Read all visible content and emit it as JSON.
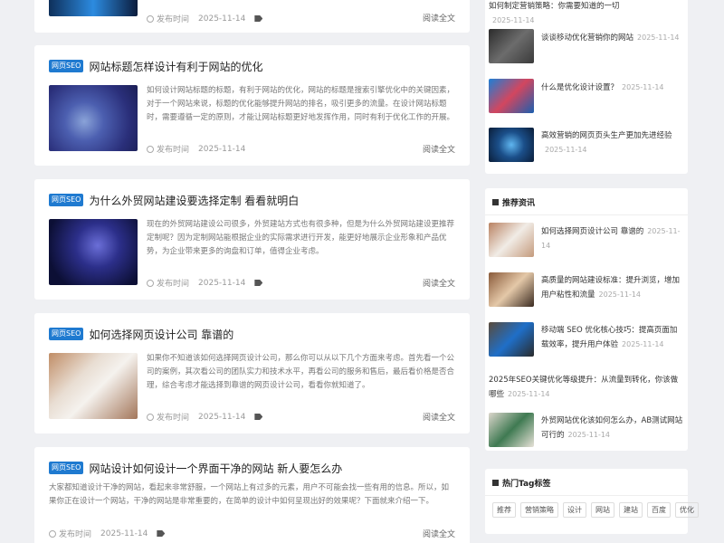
{
  "top_article": {
    "meta": {
      "author": "发布时间",
      "date": "2025-11-14"
    },
    "readmore": "阅读全文"
  },
  "articles": [
    {
      "badge": "网页SEO",
      "title": "网站标题怎样设计有利于网站的优化",
      "excerpt": "如何设计网站标题的标题，有利于网站的优化，网站的标题是搜索引擎优化中的关键因素，对于一个网站来说，标题的优化能够提升网站的排名，吸引更多的流量。在设计网站标题时，需要遵循一定的原则，才能让网站标题更好地发挥作用，同时有利于优化工作的开展。",
      "meta": {
        "author": "发布时间",
        "date": "2025-11-14"
      },
      "readmore": "阅读全文"
    },
    {
      "badge": "网页SEO",
      "title": "为什么外贸网站建设要选择定制 看看就明白",
      "excerpt": "现在的外贸网站建设公司很多，外贸建站方式也有很多种，但是为什么外贸网站建设更推荐定制呢？因为定制网站能根据企业的实际需求进行开发，能更好地展示企业形象和产品优势，为企业带来更多的询盘和订单，值得企业考虑。",
      "meta": {
        "author": "发布时间",
        "date": "2025-11-14"
      },
      "readmore": "阅读全文"
    },
    {
      "badge": "网页SEO",
      "title": "如何选择网页设计公司 靠谱的",
      "excerpt": "如果你不知道该如何选择网页设计公司，那么你可以从以下几个方面来考虑。首先看一个公司的案例，其次看公司的团队实力和技术水平，再看公司的服务和售后，最后看价格是否合理，综合考虑才能选择到靠谱的网页设计公司，看看你就知道了。",
      "meta": {
        "author": "发布时间",
        "date": "2025-11-14"
      },
      "readmore": "阅读全文"
    },
    {
      "badge": "网页SEO",
      "title": "网站设计如何设计一个界面干净的网站 新人要怎么办",
      "excerpt": "大家都知道设计干净的网站，看起来非常舒服，一个网站上有过多的元素，用户不可能会找一些有用的信息。所以，如果你正在设计一个网站，干净的网站是非常重要的，在简单的设计中如何呈现出好的效果呢？下面就来介绍一下。",
      "meta": {
        "author": "发布时间",
        "date": "2025-11-14"
      },
      "readmore": "阅读全文"
    }
  ],
  "sidebar": {
    "top_list": [
      {
        "title": "如何制定营销策略：你需要知道的一切",
        "date": "2025-11-14"
      },
      {
        "title": "谈谈移动优化营销你的网站",
        "date": "2025-11-14"
      },
      {
        "title": "什么是优化设计设置？",
        "date": "2025-11-14"
      },
      {
        "title": "高效营销的网页页头生产更加先进经验",
        "date": "2025-11-14"
      }
    ],
    "recommend": {
      "heading": "推荐资讯",
      "items": [
        {
          "title": "如何选择网页设计公司 靠谱的",
          "date": "2025-11-14"
        },
        {
          "title": "高质量的网站建设标准：提升浏览，增加用户粘性和流量",
          "date": "2025-11-14"
        },
        {
          "title": "移动端 SEO 优化核心技巧：提高页面加载效率，提升用户体验",
          "date": "2025-11-14"
        },
        {
          "title": "2025年SEO关键优化等级提升：从流量到转化，你该做哪些",
          "date": "2025-11-14"
        },
        {
          "title": "外贸网站优化该如何怎么办，AB测试网站可行的",
          "date": "2025-11-14"
        }
      ]
    },
    "hot_tags": {
      "heading": "热门Tag标签",
      "tags": [
        "推荐",
        "营销策略",
        "设计",
        "网站",
        "建站",
        "百度",
        "优化"
      ]
    }
  }
}
